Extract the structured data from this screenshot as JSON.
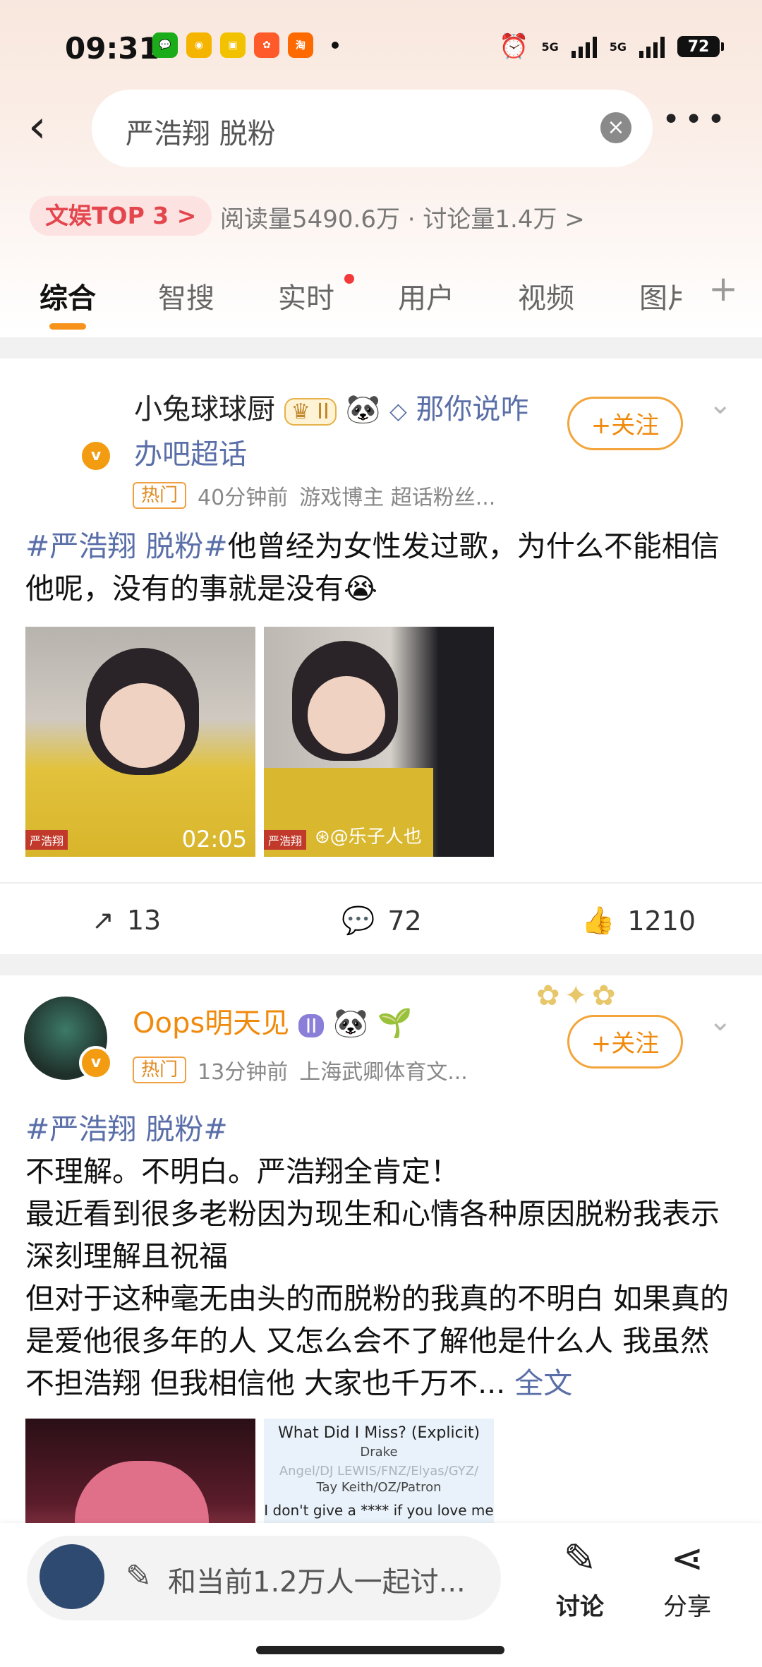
{
  "status": {
    "time": "09:31",
    "battery": "72",
    "network1": "5G",
    "network2": "5G"
  },
  "search": {
    "query": "严浩翔 脱粉"
  },
  "topic_bar": {
    "badge": "文娱TOP 3 >",
    "stats": "阅读量5490.6万 · 讨论量1.4万 >"
  },
  "tabs": [
    "综合",
    "智搜",
    "实时",
    "用户",
    "视频",
    "图片"
  ],
  "posts": [
    {
      "user": "小兔球球厨",
      "user_extra": "那你说咋办吧超话",
      "follow": "+关注",
      "hot": "热门",
      "time": "40分钟前",
      "source": "游戏博主 超话粉丝...",
      "topic": "#严浩翔 脱粉#",
      "text": "他曾经为女性发过歌，为什么不能相信他呢，没有的事就是没有😭",
      "video_duration": "02:05",
      "watermark": "@乐子人也",
      "video_label": "严浩翔",
      "actions": {
        "share": "13",
        "comment": "72",
        "like": "1210"
      }
    },
    {
      "user": "Oops明天见",
      "follow": "+关注",
      "hot": "热门",
      "time": "13分钟前",
      "source": "上海武卿体育文...",
      "topic": "#严浩翔 脱粉#",
      "lines": [
        "不理解。不明白。严浩翔全肯定！",
        "最近看到很多老粉因为现生和心情各种原因脱粉我表示深刻理解且祝福",
        "但对于这种毫无由头的而脱粉的我真的不明白 如果真的是爱他很多年的人 又怎么会不了解他是什么人 我虽然不担浩翔 但我相信他 大家也千万不..."
      ],
      "full": "全文",
      "lyrics": {
        "title": "What Did I Miss? (Explicit)",
        "artist": "Drake",
        "credits1": "Angel/DJ LEWIS/FNZ/Elyas/GYZ/",
        "credits2": "Tay Keith/OZ/Patron",
        "line": "I don't give a **** if you love me"
      }
    }
  ],
  "bottom": {
    "composer": "和当前1.2万人一起讨...",
    "discuss": "讨论",
    "share": "分享"
  }
}
